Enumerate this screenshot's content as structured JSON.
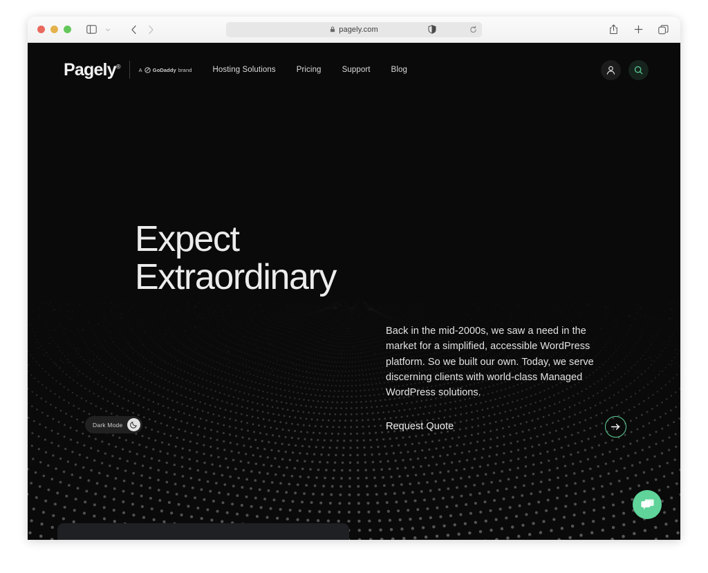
{
  "browser": {
    "url": "pagely.com",
    "lock_icon": "lock-icon",
    "reload_icon": "reload-icon",
    "sidebar_icon": "sidebar-toggle-icon",
    "chevron_icon": "chevron-down-icon",
    "back_icon": "back-arrow-icon",
    "forward_icon": "forward-arrow-icon",
    "shield_icon": "privacy-shield-icon",
    "share_icon": "share-icon",
    "new_tab_icon": "plus-icon",
    "tabs_icon": "tab-overview-icon",
    "traffic_lights": [
      "close",
      "minimize",
      "zoom"
    ]
  },
  "site": {
    "brand": {
      "name": "Pagely",
      "registered_mark": "®",
      "tagline_prefix": "A",
      "tagline_brand": "GoDaddy",
      "tagline_suffix": "brand",
      "godaddy_mark_icon": "godaddy-logo-icon"
    },
    "nav": [
      {
        "label": "Hosting Solutions"
      },
      {
        "label": "Pricing"
      },
      {
        "label": "Support"
      },
      {
        "label": "Blog"
      }
    ],
    "header_actions": {
      "account_icon": "user-account-icon",
      "search_icon": "search-icon"
    },
    "hero": {
      "title": "Expect\nExtraordinary",
      "paragraph": "Back in the mid-2000s, we saw a need in the market for a simplified, accessible WordPress platform. So we built our own. Today, we serve discerning clients with world-class Managed WordPress solutions.",
      "cta_label": "Request Quote",
      "cta_arrow_icon": "arrow-right-icon"
    },
    "dark_mode_toggle": {
      "label": "Dark Mode",
      "icon": "moon-icon"
    },
    "chat": {
      "icon": "chat-bubble-icon"
    }
  },
  "colors": {
    "accent_green": "#5fd39a",
    "page_background": "#0a0a0a",
    "text_primary": "#ececec",
    "chrome_background": "#f2f2f2"
  }
}
